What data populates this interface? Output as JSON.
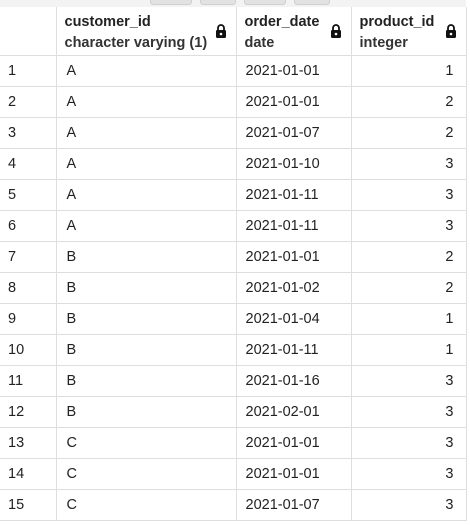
{
  "columns": [
    {
      "name": "customer_id",
      "type": "character varying (1)",
      "icon": "lock-icon"
    },
    {
      "name": "order_date",
      "type": "date",
      "icon": "lock-icon"
    },
    {
      "name": "product_id",
      "type": "integer",
      "icon": "lock-icon"
    }
  ],
  "rows": [
    {
      "index": "1",
      "customer_id": "A",
      "order_date": "2021-01-01",
      "product_id": "1"
    },
    {
      "index": "2",
      "customer_id": "A",
      "order_date": "2021-01-01",
      "product_id": "2"
    },
    {
      "index": "3",
      "customer_id": "A",
      "order_date": "2021-01-07",
      "product_id": "2"
    },
    {
      "index": "4",
      "customer_id": "A",
      "order_date": "2021-01-10",
      "product_id": "3"
    },
    {
      "index": "5",
      "customer_id": "A",
      "order_date": "2021-01-11",
      "product_id": "3"
    },
    {
      "index": "6",
      "customer_id": "A",
      "order_date": "2021-01-11",
      "product_id": "3"
    },
    {
      "index": "7",
      "customer_id": "B",
      "order_date": "2021-01-01",
      "product_id": "2"
    },
    {
      "index": "8",
      "customer_id": "B",
      "order_date": "2021-01-02",
      "product_id": "2"
    },
    {
      "index": "9",
      "customer_id": "B",
      "order_date": "2021-01-04",
      "product_id": "1"
    },
    {
      "index": "10",
      "customer_id": "B",
      "order_date": "2021-01-11",
      "product_id": "1"
    },
    {
      "index": "11",
      "customer_id": "B",
      "order_date": "2021-01-16",
      "product_id": "3"
    },
    {
      "index": "12",
      "customer_id": "B",
      "order_date": "2021-02-01",
      "product_id": "3"
    },
    {
      "index": "13",
      "customer_id": "C",
      "order_date": "2021-01-01",
      "product_id": "3"
    },
    {
      "index": "14",
      "customer_id": "C",
      "order_date": "2021-01-01",
      "product_id": "3"
    },
    {
      "index": "15",
      "customer_id": "C",
      "order_date": "2021-01-07",
      "product_id": "3"
    }
  ]
}
